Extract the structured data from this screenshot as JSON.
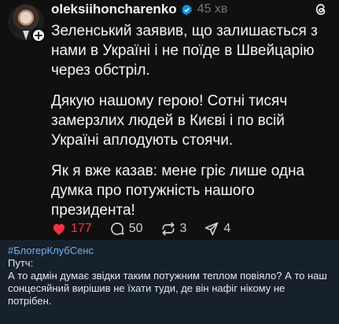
{
  "post": {
    "username": "oleksiihoncharenko",
    "time": "45 хв",
    "paragraphs": [
      "Зеленський заявив, що залишається з нами в Україні і не поїде в Швейцарію через обстріл.",
      "Дякую нашому герою! Сотні тисяч замерзлих людей в Києві і по всій Україні аплодують стоячи.",
      "Як я вже казав: мене гріє лише одна думка про потужність нашого президента!"
    ],
    "actions": {
      "likes": "177",
      "comments": "50",
      "reposts": "3",
      "shares": "4"
    },
    "icons": [
      "heart-icon",
      "comment-icon",
      "repost-icon",
      "share-icon",
      "verified-badge-icon",
      "threads-logo-icon",
      "follow-plus-icon"
    ],
    "colors": {
      "like": "#ff3040",
      "verified": "#0095f6",
      "background": "#101010"
    }
  },
  "channel": {
    "hashtag": "#БлогерКлубСенс",
    "line1": "Путч:",
    "line2": "А то адмін думає звідки таким потужним теплом повіяло? А то наш сонцесяйний вирішив не їхати туди, де він нафіг нікому не потрібен.",
    "colors": {
      "background": "#17212b",
      "hashtag": "#6ab3f3"
    }
  }
}
